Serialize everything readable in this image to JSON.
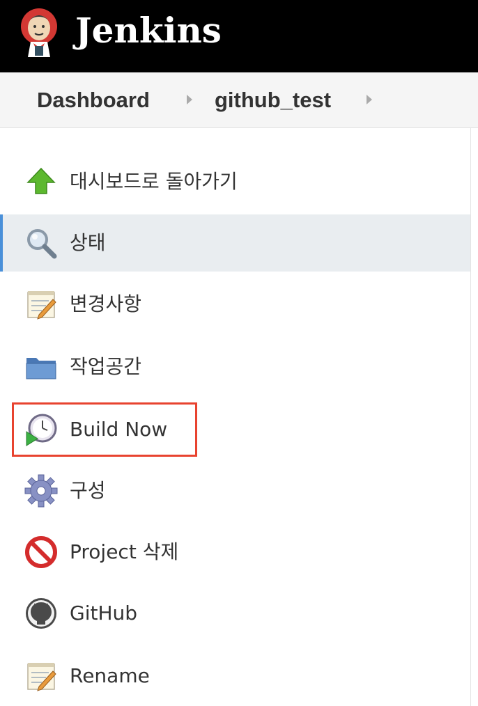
{
  "header": {
    "title": "Jenkins",
    "logo_icon": "jenkins-butler-logo",
    "background": "#000000"
  },
  "breadcrumb": {
    "items": [
      {
        "label": "Dashboard"
      },
      {
        "label": "github_test"
      }
    ],
    "separator_icon": "chevron-right-icon"
  },
  "sidebar": {
    "items": [
      {
        "label": "대시보드로 돌아가기",
        "icon": "up-arrow-icon"
      },
      {
        "label": "상태",
        "icon": "magnifier-icon",
        "active": true
      },
      {
        "label": "변경사항",
        "icon": "notepad-icon"
      },
      {
        "label": "작업공간",
        "icon": "folder-icon"
      },
      {
        "label": "Build Now",
        "icon": "build-clock-icon",
        "highlighted": true
      },
      {
        "label": "구성",
        "icon": "gear-icon"
      },
      {
        "label": "Project 삭제",
        "icon": "no-entry-icon"
      },
      {
        "label": "GitHub",
        "icon": "github-icon"
      },
      {
        "label": "Rename",
        "icon": "notepad-icon"
      }
    ]
  },
  "colors": {
    "active_bg": "#e9edf0",
    "active_accent": "#4a90d9",
    "highlight_border": "#e8432f",
    "text": "#333333"
  }
}
